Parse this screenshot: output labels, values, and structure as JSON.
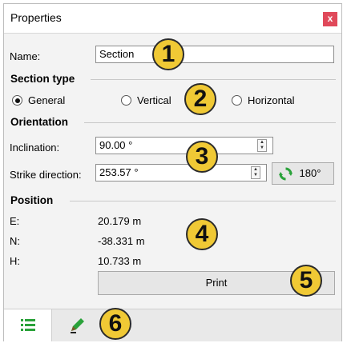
{
  "window": {
    "title": "Properties",
    "close_glyph": "x"
  },
  "name_field": {
    "label": "Name:",
    "value": "Section"
  },
  "section_type": {
    "heading": "Section type",
    "options": [
      {
        "label": "General",
        "selected": true
      },
      {
        "label": "Vertical",
        "selected": false
      },
      {
        "label": "Horizontal",
        "selected": false
      }
    ]
  },
  "orientation": {
    "heading": "Orientation",
    "inclination": {
      "label": "Inclination:",
      "value": "90.00 °"
    },
    "strike": {
      "label": "Strike direction:",
      "value": "253.57 °"
    },
    "rotate_button": {
      "label": "180°",
      "icon": "rotate-arrows-icon"
    }
  },
  "position": {
    "heading": "Position",
    "rows": [
      {
        "label": "E:",
        "value": "20.179 m"
      },
      {
        "label": "N:",
        "value": "-38.331 m"
      },
      {
        "label": "H:",
        "value": "10.733 m"
      }
    ]
  },
  "print_button": {
    "label": "Print"
  },
  "tabs": [
    {
      "icon": "properties-list-icon"
    },
    {
      "icon": "edit-pencil-icon"
    }
  ],
  "callouts": [
    "1",
    "2",
    "3",
    "4",
    "5",
    "6"
  ],
  "colors": {
    "callout": "#f0c935",
    "close": "#e0495a",
    "icon_green": "#2aa23a"
  }
}
